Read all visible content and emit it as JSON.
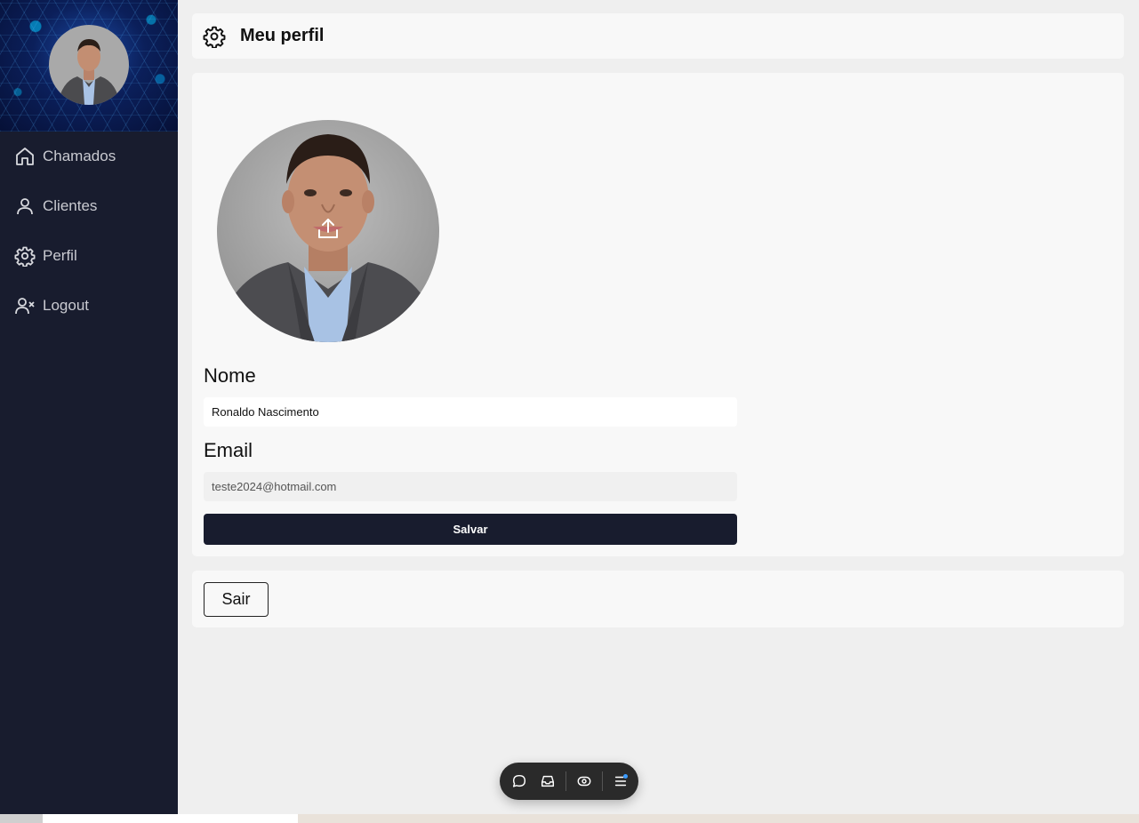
{
  "sidebar": {
    "items": [
      {
        "label": "Chamados",
        "icon": "home-icon"
      },
      {
        "label": "Clientes",
        "icon": "user-icon"
      },
      {
        "label": "Perfil",
        "icon": "gear-icon"
      },
      {
        "label": "Logout",
        "icon": "user-x-icon"
      }
    ]
  },
  "header": {
    "title": "Meu perfil",
    "icon": "gear-icon"
  },
  "profile": {
    "name_label": "Nome",
    "name_value": "Ronaldo Nascimento",
    "email_label": "Email",
    "email_value": "teste2024@hotmail.com",
    "save_label": "Salvar",
    "upload_icon": "upload-icon"
  },
  "logout": {
    "button_label": "Sair"
  },
  "toolbar": {
    "icons": [
      "chat-bubble-icon",
      "inbox-icon",
      "eye-icon",
      "menu-icon"
    ]
  },
  "colors": {
    "sidebar_bg": "#181c2e",
    "accent": "#181c2e",
    "card_bg": "#f8f8f8",
    "page_bg": "#efefef"
  }
}
